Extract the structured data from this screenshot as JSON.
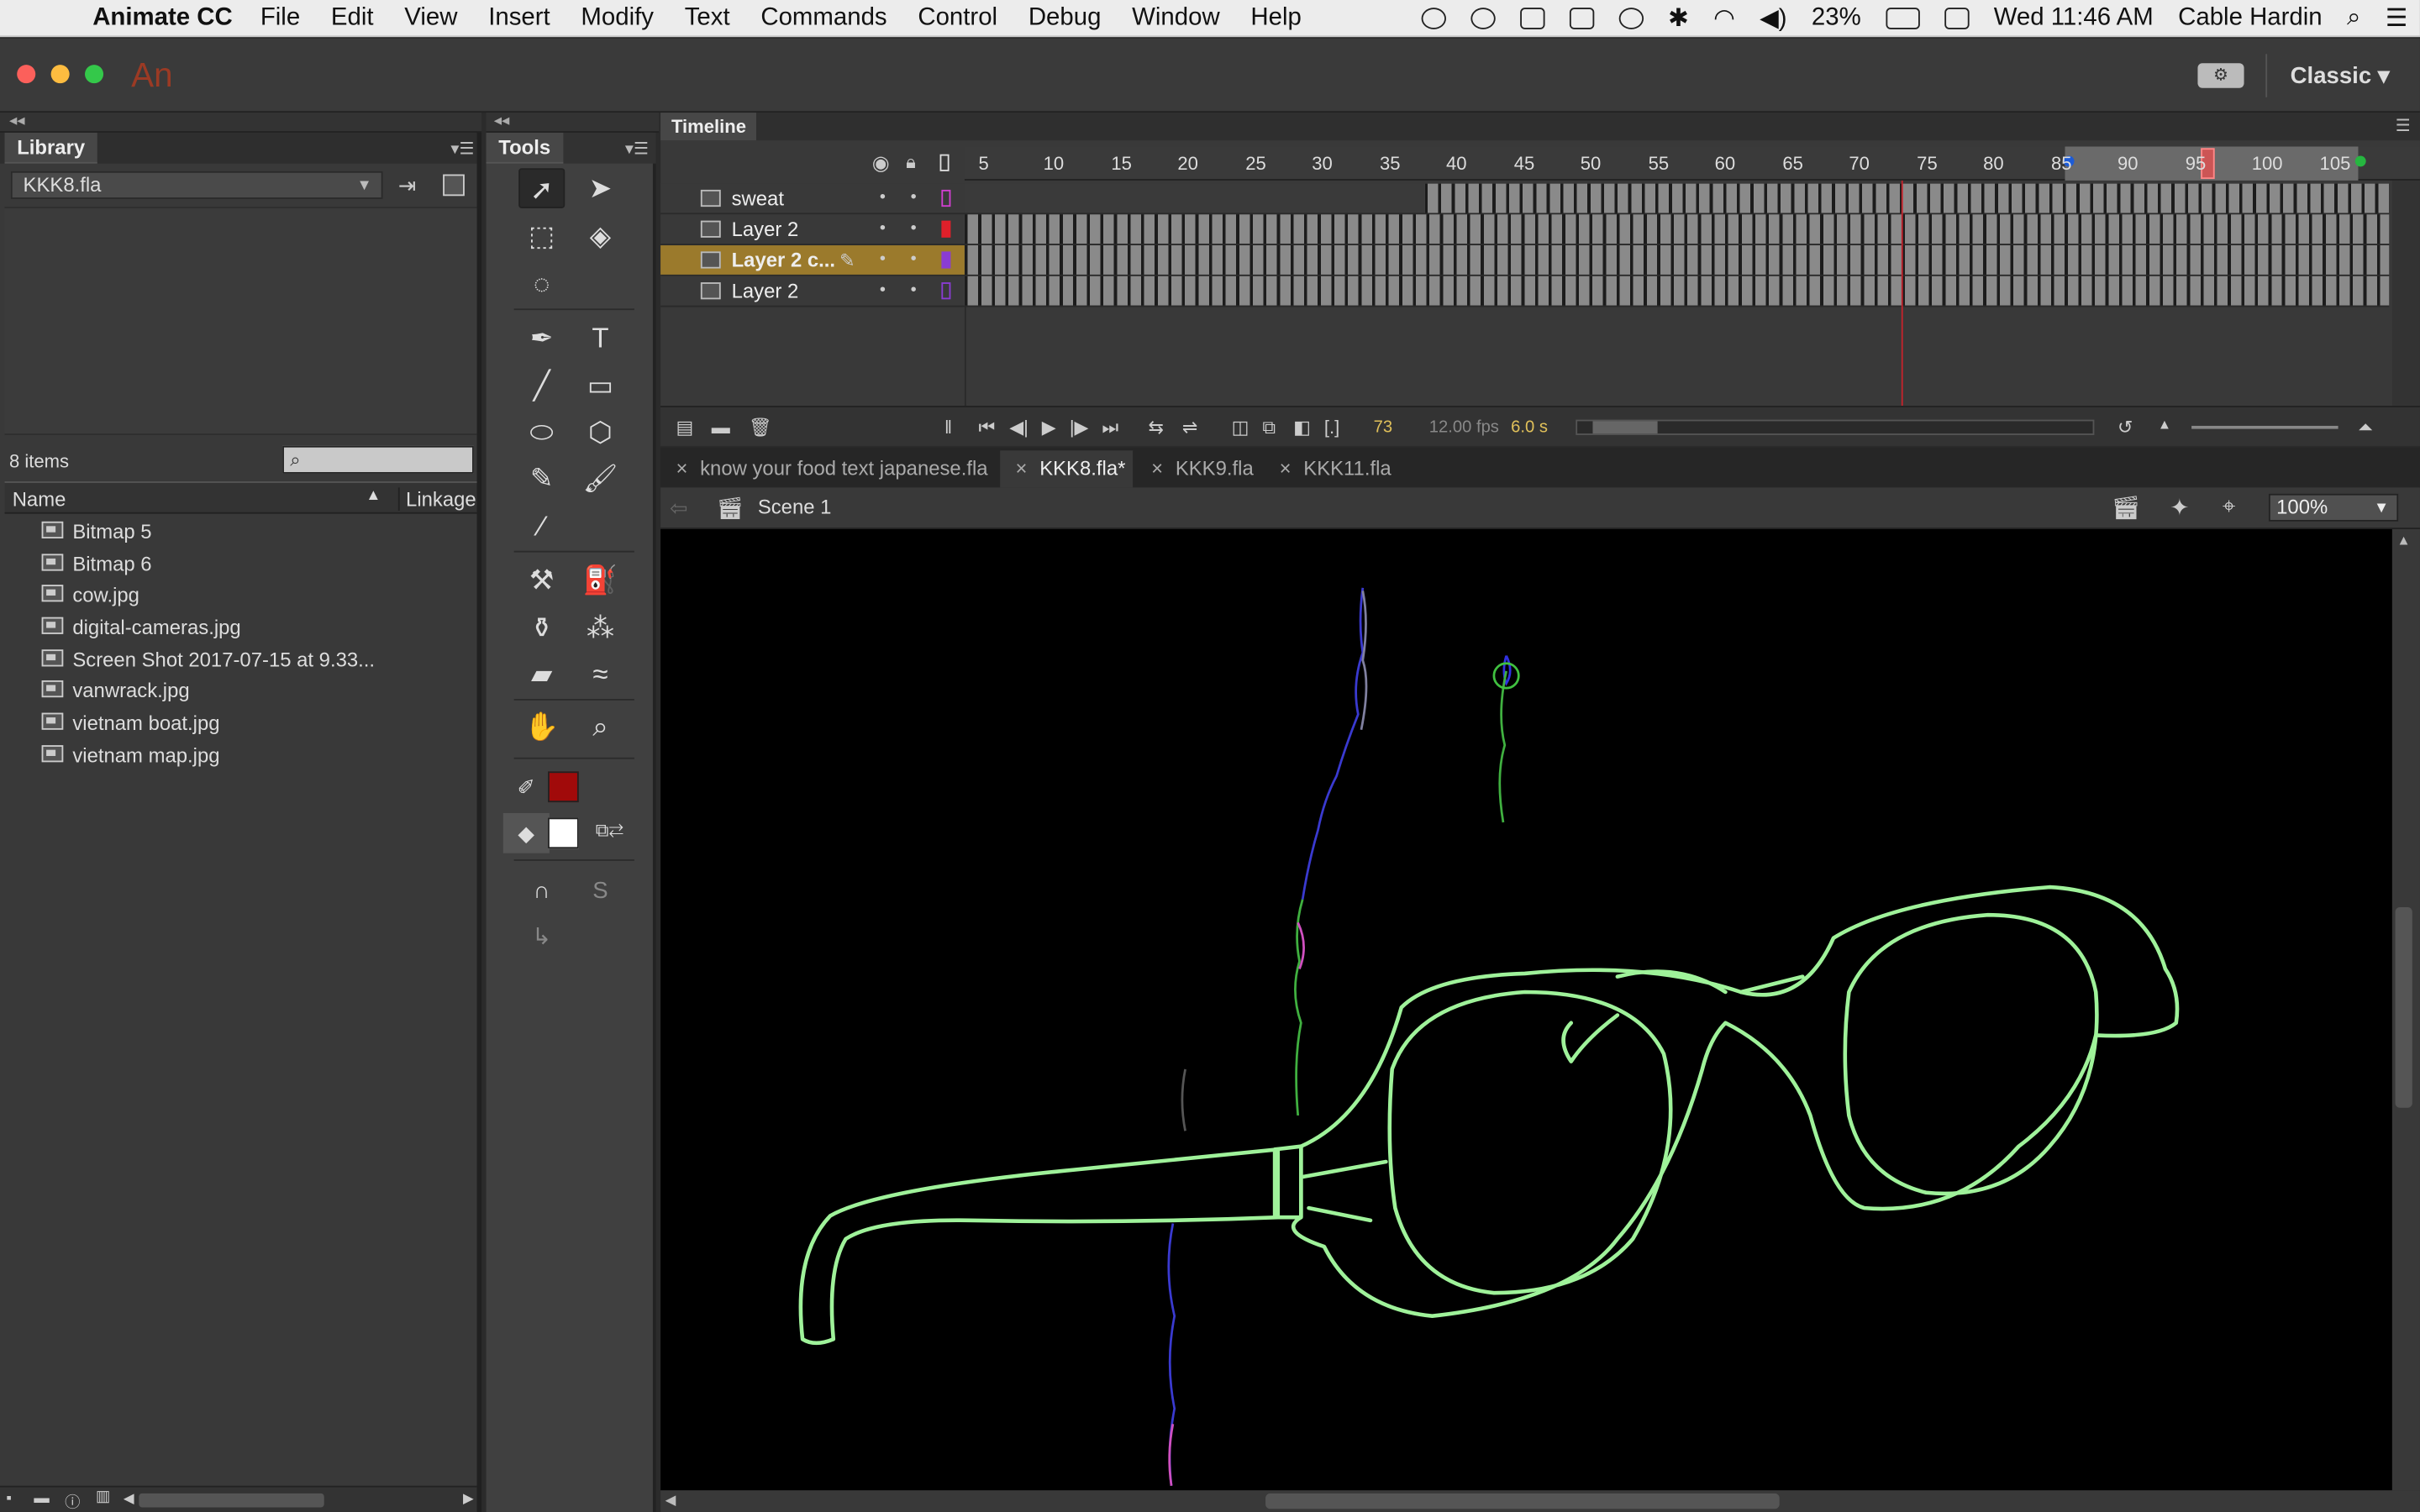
{
  "menubar": {
    "app_name": "Animate CC",
    "items": [
      "File",
      "Edit",
      "View",
      "Insert",
      "Modify",
      "Text",
      "Commands",
      "Control",
      "Debug",
      "Window",
      "Help"
    ],
    "battery": "23%",
    "clock": "Wed 11:46 AM",
    "user": "Cable Hardin"
  },
  "titlebar": {
    "logo": "An",
    "workspace": "Classic"
  },
  "library": {
    "tab": "Library",
    "file": "KKK8.fla",
    "item_count": "8 items",
    "col_name": "Name",
    "col_linkage": "Linkage",
    "items": [
      "Bitmap 5",
      "Bitmap 6",
      "cow.jpg",
      "digital-cameras.jpg",
      "Screen Shot 2017-07-15 at 9.33...",
      "vanwrack.jpg",
      "vietnam boat.jpg",
      "vietnam map.jpg"
    ]
  },
  "tools": {
    "tab": "Tools",
    "stroke_color": "#a10a0a",
    "fill_color": "#ffffff"
  },
  "timeline": {
    "tab": "Timeline",
    "ruler_ticks": [
      "5",
      "10",
      "15",
      "20",
      "25",
      "30",
      "35",
      "40",
      "45",
      "50",
      "55",
      "60",
      "65",
      "70",
      "75",
      "80",
      "85",
      "90",
      "95",
      "100",
      "105"
    ],
    "layers": [
      {
        "name": "sweat",
        "color": "#d23fd2"
      },
      {
        "name": "Layer 2",
        "color": "#e0202a"
      },
      {
        "name": "Layer 2 c...",
        "color": "#8a3cd4"
      },
      {
        "name": "Layer 2",
        "color": "#8a3cd4"
      }
    ],
    "current_frame": "73",
    "fps": "12.00 fps",
    "seconds": "6.0 s"
  },
  "documents": {
    "tabs": [
      "know your food text japanese.fla",
      "KKK8.fla*",
      "KKK9.fla",
      "KKK11.fla"
    ],
    "active": "KKK8.fla*"
  },
  "scene": {
    "label": "Scene 1",
    "zoom": "100%"
  },
  "stage": {
    "background": "#000000",
    "stroke_green": "#9ff29a",
    "stroke_blue": "#2f2fb8",
    "stroke_pink": "#d050c0"
  }
}
